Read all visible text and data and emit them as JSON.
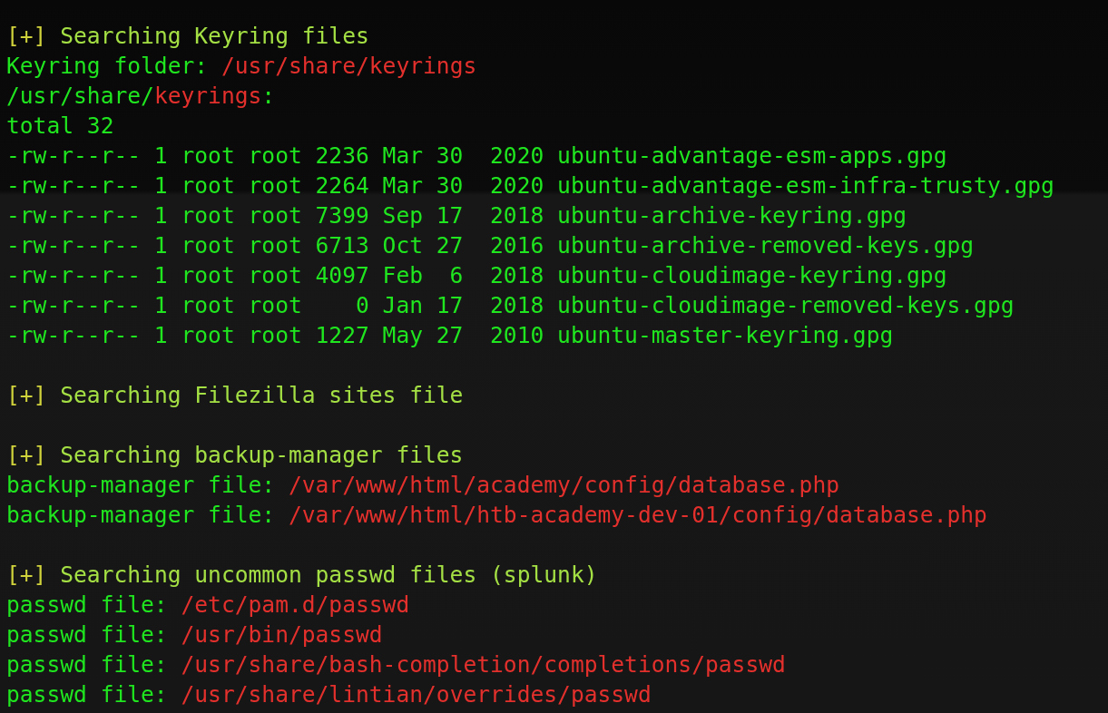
{
  "terminal": {
    "lines": [
      {
        "kind": "output",
        "segments": [
          {
            "kind": "bracket",
            "text": "[+]"
          },
          {
            "kind": "heading",
            "text": " Searching Keyring files"
          }
        ]
      },
      {
        "kind": "output",
        "segments": [
          {
            "kind": "text",
            "text": "Keyring folder: "
          },
          {
            "kind": "path",
            "text": "/usr/share/keyrings"
          }
        ]
      },
      {
        "kind": "output",
        "segments": [
          {
            "kind": "text",
            "text": "/usr/share/"
          },
          {
            "kind": "path",
            "text": "keyrings"
          },
          {
            "kind": "text",
            "text": ":"
          }
        ]
      },
      {
        "kind": "output",
        "segments": [
          {
            "kind": "text",
            "text": "total 32"
          }
        ]
      },
      {
        "kind": "output",
        "segments": [
          {
            "kind": "text",
            "text": "-rw-r--r-- 1 root root 2236 Mar 30  2020 ubuntu-advantage-esm-apps.gpg"
          }
        ]
      },
      {
        "kind": "output",
        "segments": [
          {
            "kind": "text",
            "text": "-rw-r--r-- 1 root root 2264 Mar 30  2020 ubuntu-advantage-esm-infra-trusty.gpg"
          }
        ]
      },
      {
        "kind": "output",
        "segments": [
          {
            "kind": "text",
            "text": "-rw-r--r-- 1 root root 7399 Sep 17  2018 ubuntu-archive-keyring.gpg"
          }
        ]
      },
      {
        "kind": "output",
        "segments": [
          {
            "kind": "text",
            "text": "-rw-r--r-- 1 root root 6713 Oct 27  2016 ubuntu-archive-removed-keys.gpg"
          }
        ]
      },
      {
        "kind": "output",
        "segments": [
          {
            "kind": "text",
            "text": "-rw-r--r-- 1 root root 4097 Feb  6  2018 ubuntu-cloudimage-keyring.gpg"
          }
        ]
      },
      {
        "kind": "output",
        "segments": [
          {
            "kind": "text",
            "text": "-rw-r--r-- 1 root root    0 Jan 17  2018 ubuntu-cloudimage-removed-keys.gpg"
          }
        ]
      },
      {
        "kind": "output",
        "segments": [
          {
            "kind": "text",
            "text": "-rw-r--r-- 1 root root 1227 May 27  2010 ubuntu-master-keyring.gpg"
          }
        ]
      },
      {
        "kind": "blank"
      },
      {
        "kind": "output",
        "segments": [
          {
            "kind": "bracket",
            "text": "[+]"
          },
          {
            "kind": "heading",
            "text": " Searching Filezilla sites file"
          }
        ]
      },
      {
        "kind": "blank"
      },
      {
        "kind": "output",
        "segments": [
          {
            "kind": "bracket",
            "text": "[+]"
          },
          {
            "kind": "heading",
            "text": " Searching backup-manager files"
          }
        ]
      },
      {
        "kind": "output",
        "segments": [
          {
            "kind": "text",
            "text": "backup-manager file: "
          },
          {
            "kind": "path",
            "text": "/var/www/html/academy/config/database.php"
          }
        ]
      },
      {
        "kind": "output",
        "segments": [
          {
            "kind": "text",
            "text": "backup-manager file: "
          },
          {
            "kind": "path",
            "text": "/var/www/html/htb-academy-dev-01/config/database.php"
          }
        ]
      },
      {
        "kind": "blank"
      },
      {
        "kind": "output",
        "segments": [
          {
            "kind": "bracket",
            "text": "[+]"
          },
          {
            "kind": "heading",
            "text": " Searching uncommon passwd files (splunk)"
          }
        ]
      },
      {
        "kind": "output",
        "segments": [
          {
            "kind": "text",
            "text": "passwd file: "
          },
          {
            "kind": "path",
            "text": "/etc/pam.d/passwd"
          }
        ]
      },
      {
        "kind": "output",
        "segments": [
          {
            "kind": "text",
            "text": "passwd file: "
          },
          {
            "kind": "path",
            "text": "/usr/bin/passwd"
          }
        ]
      },
      {
        "kind": "output",
        "segments": [
          {
            "kind": "text",
            "text": "passwd file: "
          },
          {
            "kind": "path",
            "text": "/usr/share/bash-completion/completions/passwd"
          }
        ]
      },
      {
        "kind": "output",
        "segments": [
          {
            "kind": "text",
            "text": "passwd file: "
          },
          {
            "kind": "path",
            "text": "/usr/share/lintian/overrides/passwd"
          }
        ]
      }
    ]
  }
}
